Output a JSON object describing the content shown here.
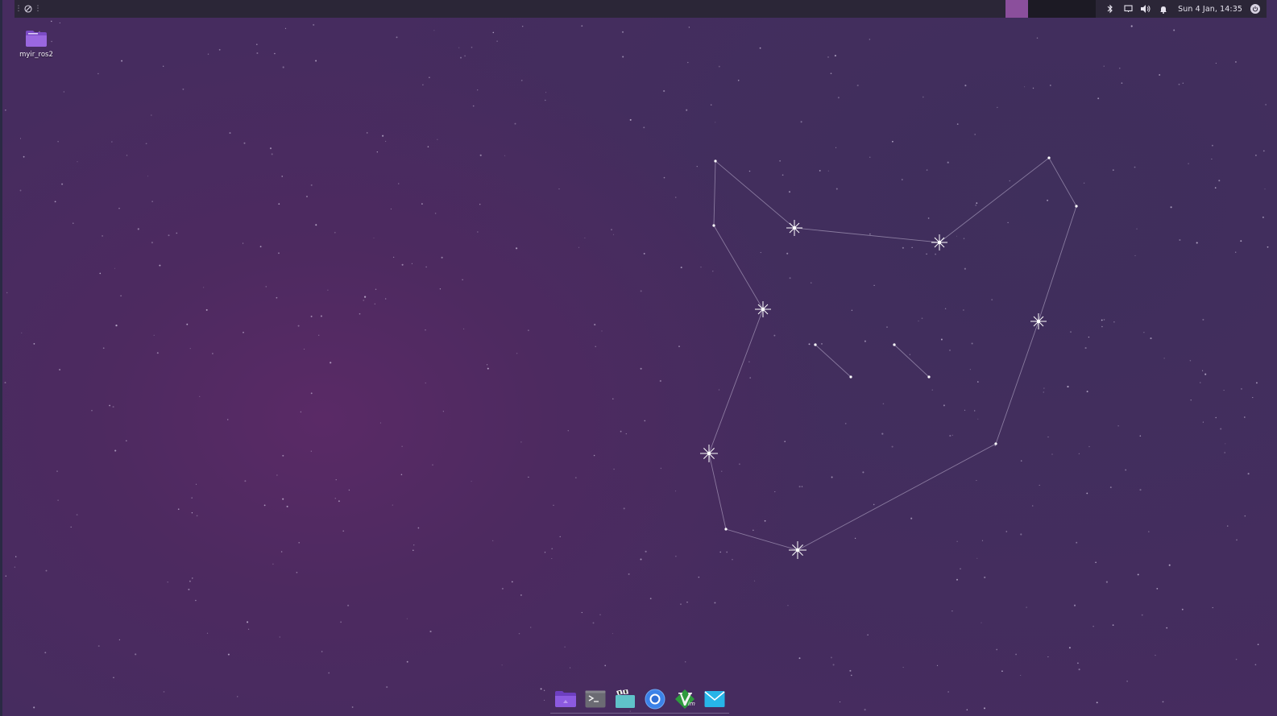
{
  "top_panel": {
    "clock": "Sun  4 Jan, 14:35",
    "workspaces": [
      {
        "state": "active"
      },
      {
        "state": "inactive"
      },
      {
        "state": "inactive"
      },
      {
        "state": "inactive"
      }
    ],
    "tray_icons": [
      "bluetooth-icon",
      "display-icon",
      "volume-icon",
      "notification-bell-icon"
    ],
    "session_icon": "power-icon"
  },
  "desktop": {
    "icons": [
      {
        "label": "myir_ros2",
        "icon": "folder-icon"
      }
    ]
  },
  "dock": {
    "apps": [
      "files-icon",
      "terminal-icon",
      "video-editor-icon",
      "browser-icon",
      "vim-icon",
      "mail-icon"
    ]
  },
  "colors": {
    "panel_bg": "#2b2637",
    "workspace_active": "#8b4f9c",
    "wallpaper_base": "#462c5f"
  }
}
